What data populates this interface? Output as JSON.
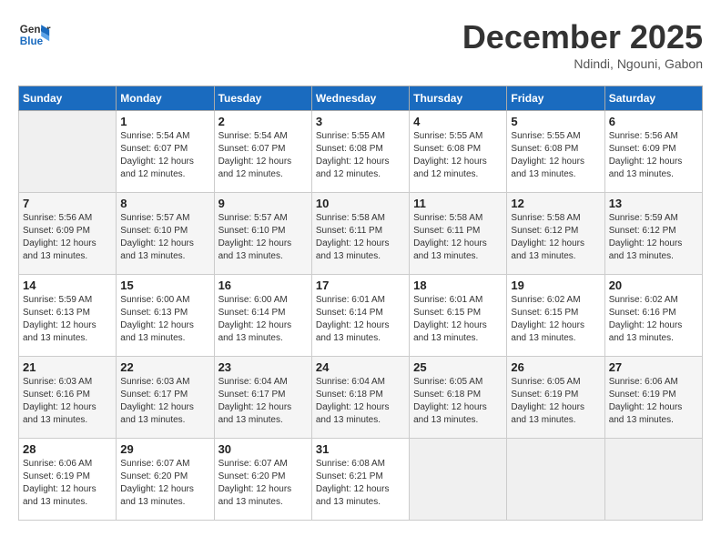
{
  "logo": {
    "line1": "General",
    "line2": "Blue"
  },
  "title": "December 2025",
  "subtitle": "Ndindi, Ngouni, Gabon",
  "header": {
    "days": [
      "Sunday",
      "Monday",
      "Tuesday",
      "Wednesday",
      "Thursday",
      "Friday",
      "Saturday"
    ]
  },
  "weeks": [
    [
      {
        "day": "",
        "detail": ""
      },
      {
        "day": "1",
        "detail": "Sunrise: 5:54 AM\nSunset: 6:07 PM\nDaylight: 12 hours\nand 12 minutes."
      },
      {
        "day": "2",
        "detail": "Sunrise: 5:54 AM\nSunset: 6:07 PM\nDaylight: 12 hours\nand 12 minutes."
      },
      {
        "day": "3",
        "detail": "Sunrise: 5:55 AM\nSunset: 6:08 PM\nDaylight: 12 hours\nand 12 minutes."
      },
      {
        "day": "4",
        "detail": "Sunrise: 5:55 AM\nSunset: 6:08 PM\nDaylight: 12 hours\nand 12 minutes."
      },
      {
        "day": "5",
        "detail": "Sunrise: 5:55 AM\nSunset: 6:08 PM\nDaylight: 12 hours\nand 13 minutes."
      },
      {
        "day": "6",
        "detail": "Sunrise: 5:56 AM\nSunset: 6:09 PM\nDaylight: 12 hours\nand 13 minutes."
      }
    ],
    [
      {
        "day": "7",
        "detail": "Sunrise: 5:56 AM\nSunset: 6:09 PM\nDaylight: 12 hours\nand 13 minutes."
      },
      {
        "day": "8",
        "detail": "Sunrise: 5:57 AM\nSunset: 6:10 PM\nDaylight: 12 hours\nand 13 minutes."
      },
      {
        "day": "9",
        "detail": "Sunrise: 5:57 AM\nSunset: 6:10 PM\nDaylight: 12 hours\nand 13 minutes."
      },
      {
        "day": "10",
        "detail": "Sunrise: 5:58 AM\nSunset: 6:11 PM\nDaylight: 12 hours\nand 13 minutes."
      },
      {
        "day": "11",
        "detail": "Sunrise: 5:58 AM\nSunset: 6:11 PM\nDaylight: 12 hours\nand 13 minutes."
      },
      {
        "day": "12",
        "detail": "Sunrise: 5:58 AM\nSunset: 6:12 PM\nDaylight: 12 hours\nand 13 minutes."
      },
      {
        "day": "13",
        "detail": "Sunrise: 5:59 AM\nSunset: 6:12 PM\nDaylight: 12 hours\nand 13 minutes."
      }
    ],
    [
      {
        "day": "14",
        "detail": "Sunrise: 5:59 AM\nSunset: 6:13 PM\nDaylight: 12 hours\nand 13 minutes."
      },
      {
        "day": "15",
        "detail": "Sunrise: 6:00 AM\nSunset: 6:13 PM\nDaylight: 12 hours\nand 13 minutes."
      },
      {
        "day": "16",
        "detail": "Sunrise: 6:00 AM\nSunset: 6:14 PM\nDaylight: 12 hours\nand 13 minutes."
      },
      {
        "day": "17",
        "detail": "Sunrise: 6:01 AM\nSunset: 6:14 PM\nDaylight: 12 hours\nand 13 minutes."
      },
      {
        "day": "18",
        "detail": "Sunrise: 6:01 AM\nSunset: 6:15 PM\nDaylight: 12 hours\nand 13 minutes."
      },
      {
        "day": "19",
        "detail": "Sunrise: 6:02 AM\nSunset: 6:15 PM\nDaylight: 12 hours\nand 13 minutes."
      },
      {
        "day": "20",
        "detail": "Sunrise: 6:02 AM\nSunset: 6:16 PM\nDaylight: 12 hours\nand 13 minutes."
      }
    ],
    [
      {
        "day": "21",
        "detail": "Sunrise: 6:03 AM\nSunset: 6:16 PM\nDaylight: 12 hours\nand 13 minutes."
      },
      {
        "day": "22",
        "detail": "Sunrise: 6:03 AM\nSunset: 6:17 PM\nDaylight: 12 hours\nand 13 minutes."
      },
      {
        "day": "23",
        "detail": "Sunrise: 6:04 AM\nSunset: 6:17 PM\nDaylight: 12 hours\nand 13 minutes."
      },
      {
        "day": "24",
        "detail": "Sunrise: 6:04 AM\nSunset: 6:18 PM\nDaylight: 12 hours\nand 13 minutes."
      },
      {
        "day": "25",
        "detail": "Sunrise: 6:05 AM\nSunset: 6:18 PM\nDaylight: 12 hours\nand 13 minutes."
      },
      {
        "day": "26",
        "detail": "Sunrise: 6:05 AM\nSunset: 6:19 PM\nDaylight: 12 hours\nand 13 minutes."
      },
      {
        "day": "27",
        "detail": "Sunrise: 6:06 AM\nSunset: 6:19 PM\nDaylight: 12 hours\nand 13 minutes."
      }
    ],
    [
      {
        "day": "28",
        "detail": "Sunrise: 6:06 AM\nSunset: 6:19 PM\nDaylight: 12 hours\nand 13 minutes."
      },
      {
        "day": "29",
        "detail": "Sunrise: 6:07 AM\nSunset: 6:20 PM\nDaylight: 12 hours\nand 13 minutes."
      },
      {
        "day": "30",
        "detail": "Sunrise: 6:07 AM\nSunset: 6:20 PM\nDaylight: 12 hours\nand 13 minutes."
      },
      {
        "day": "31",
        "detail": "Sunrise: 6:08 AM\nSunset: 6:21 PM\nDaylight: 12 hours\nand 13 minutes."
      },
      {
        "day": "",
        "detail": ""
      },
      {
        "day": "",
        "detail": ""
      },
      {
        "day": "",
        "detail": ""
      }
    ]
  ]
}
